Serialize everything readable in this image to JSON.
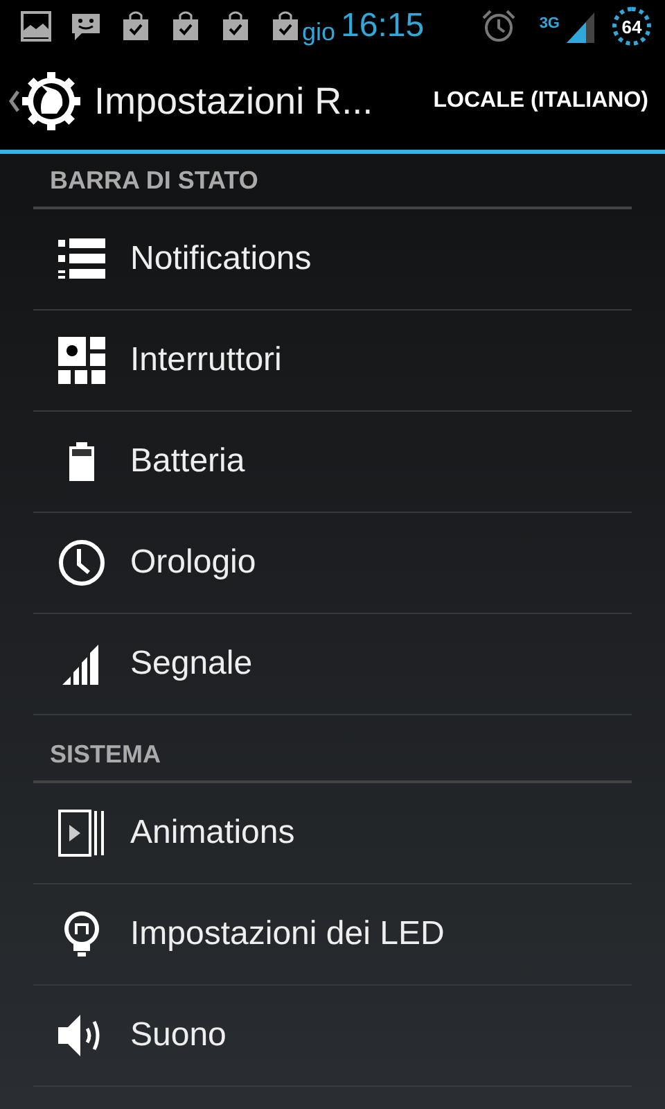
{
  "status_bar": {
    "day": "gio",
    "time": "16:15",
    "network": "3G",
    "battery": "64"
  },
  "action_bar": {
    "title": "Impostazioni R...",
    "action": "LOCALE (ITALIANO)"
  },
  "sections": [
    {
      "title": "BARRA DI STATO",
      "items": [
        {
          "label": "Notifications"
        },
        {
          "label": "Interruttori"
        },
        {
          "label": "Batteria"
        },
        {
          "label": "Orologio"
        },
        {
          "label": "Segnale"
        }
      ]
    },
    {
      "title": "SISTEMA",
      "items": [
        {
          "label": "Animations"
        },
        {
          "label": "Impostazioni dei LED"
        },
        {
          "label": "Suono"
        }
      ]
    }
  ]
}
